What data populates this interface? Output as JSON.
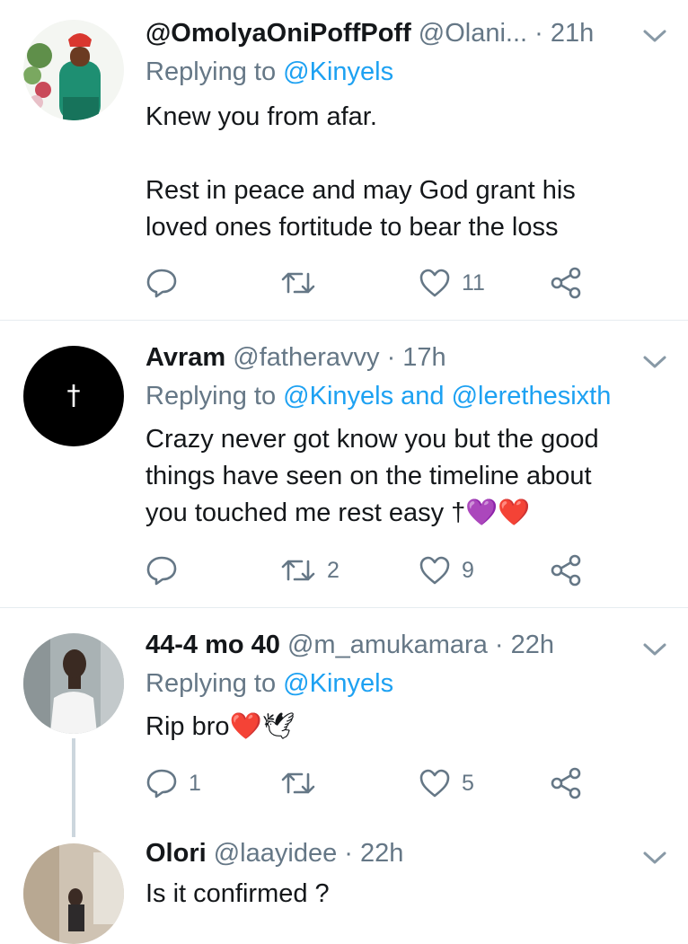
{
  "tweets": [
    {
      "display_name": "@OmolyaOniPoffPoff",
      "handle": "@Olani...",
      "time": "· 21h",
      "replying_prefix": "Replying to",
      "replying_to": "@Kinyels",
      "body_lines": [
        "Knew you from afar.",
        "",
        "Rest in peace and may God grant his",
        "loved ones fortitude to bear the loss"
      ],
      "replies": "",
      "retweets": "",
      "likes": "11"
    },
    {
      "display_name": "Avram",
      "handle": "@fatheravvy",
      "time": "· 17h",
      "replying_prefix": "Replying to",
      "replying_to": "@Kinyels",
      "replying_and": "and",
      "replying_to_2": "@lerethesixth",
      "avatar_glyph": "†",
      "body_lines": [
        "Crazy never got know you but the good",
        "things have seen on the timeline about",
        "you touched me rest easy †💜❤️"
      ],
      "replies": "",
      "retweets": "2",
      "likes": "9"
    },
    {
      "display_name": "44-4 mo 40",
      "handle": "@m_amukamara",
      "time": "· 22h",
      "replying_prefix": "Replying to",
      "replying_to": "@Kinyels",
      "body_lines": [
        "Rip bro❤️🕊"
      ],
      "replies": "1",
      "retweets": "",
      "likes": "5"
    },
    {
      "display_name": "Olori",
      "handle": "@laayidee",
      "time": "· 22h",
      "body_lines": [
        "Is it confirmed ?"
      ]
    }
  ],
  "colors": {
    "link": "#1da1f2",
    "muted": "#657786",
    "divider": "#e6ecf0",
    "text": "#14171a"
  },
  "icons": [
    "reply-icon",
    "retweet-icon",
    "like-icon",
    "share-icon",
    "chevron-down-icon"
  ]
}
